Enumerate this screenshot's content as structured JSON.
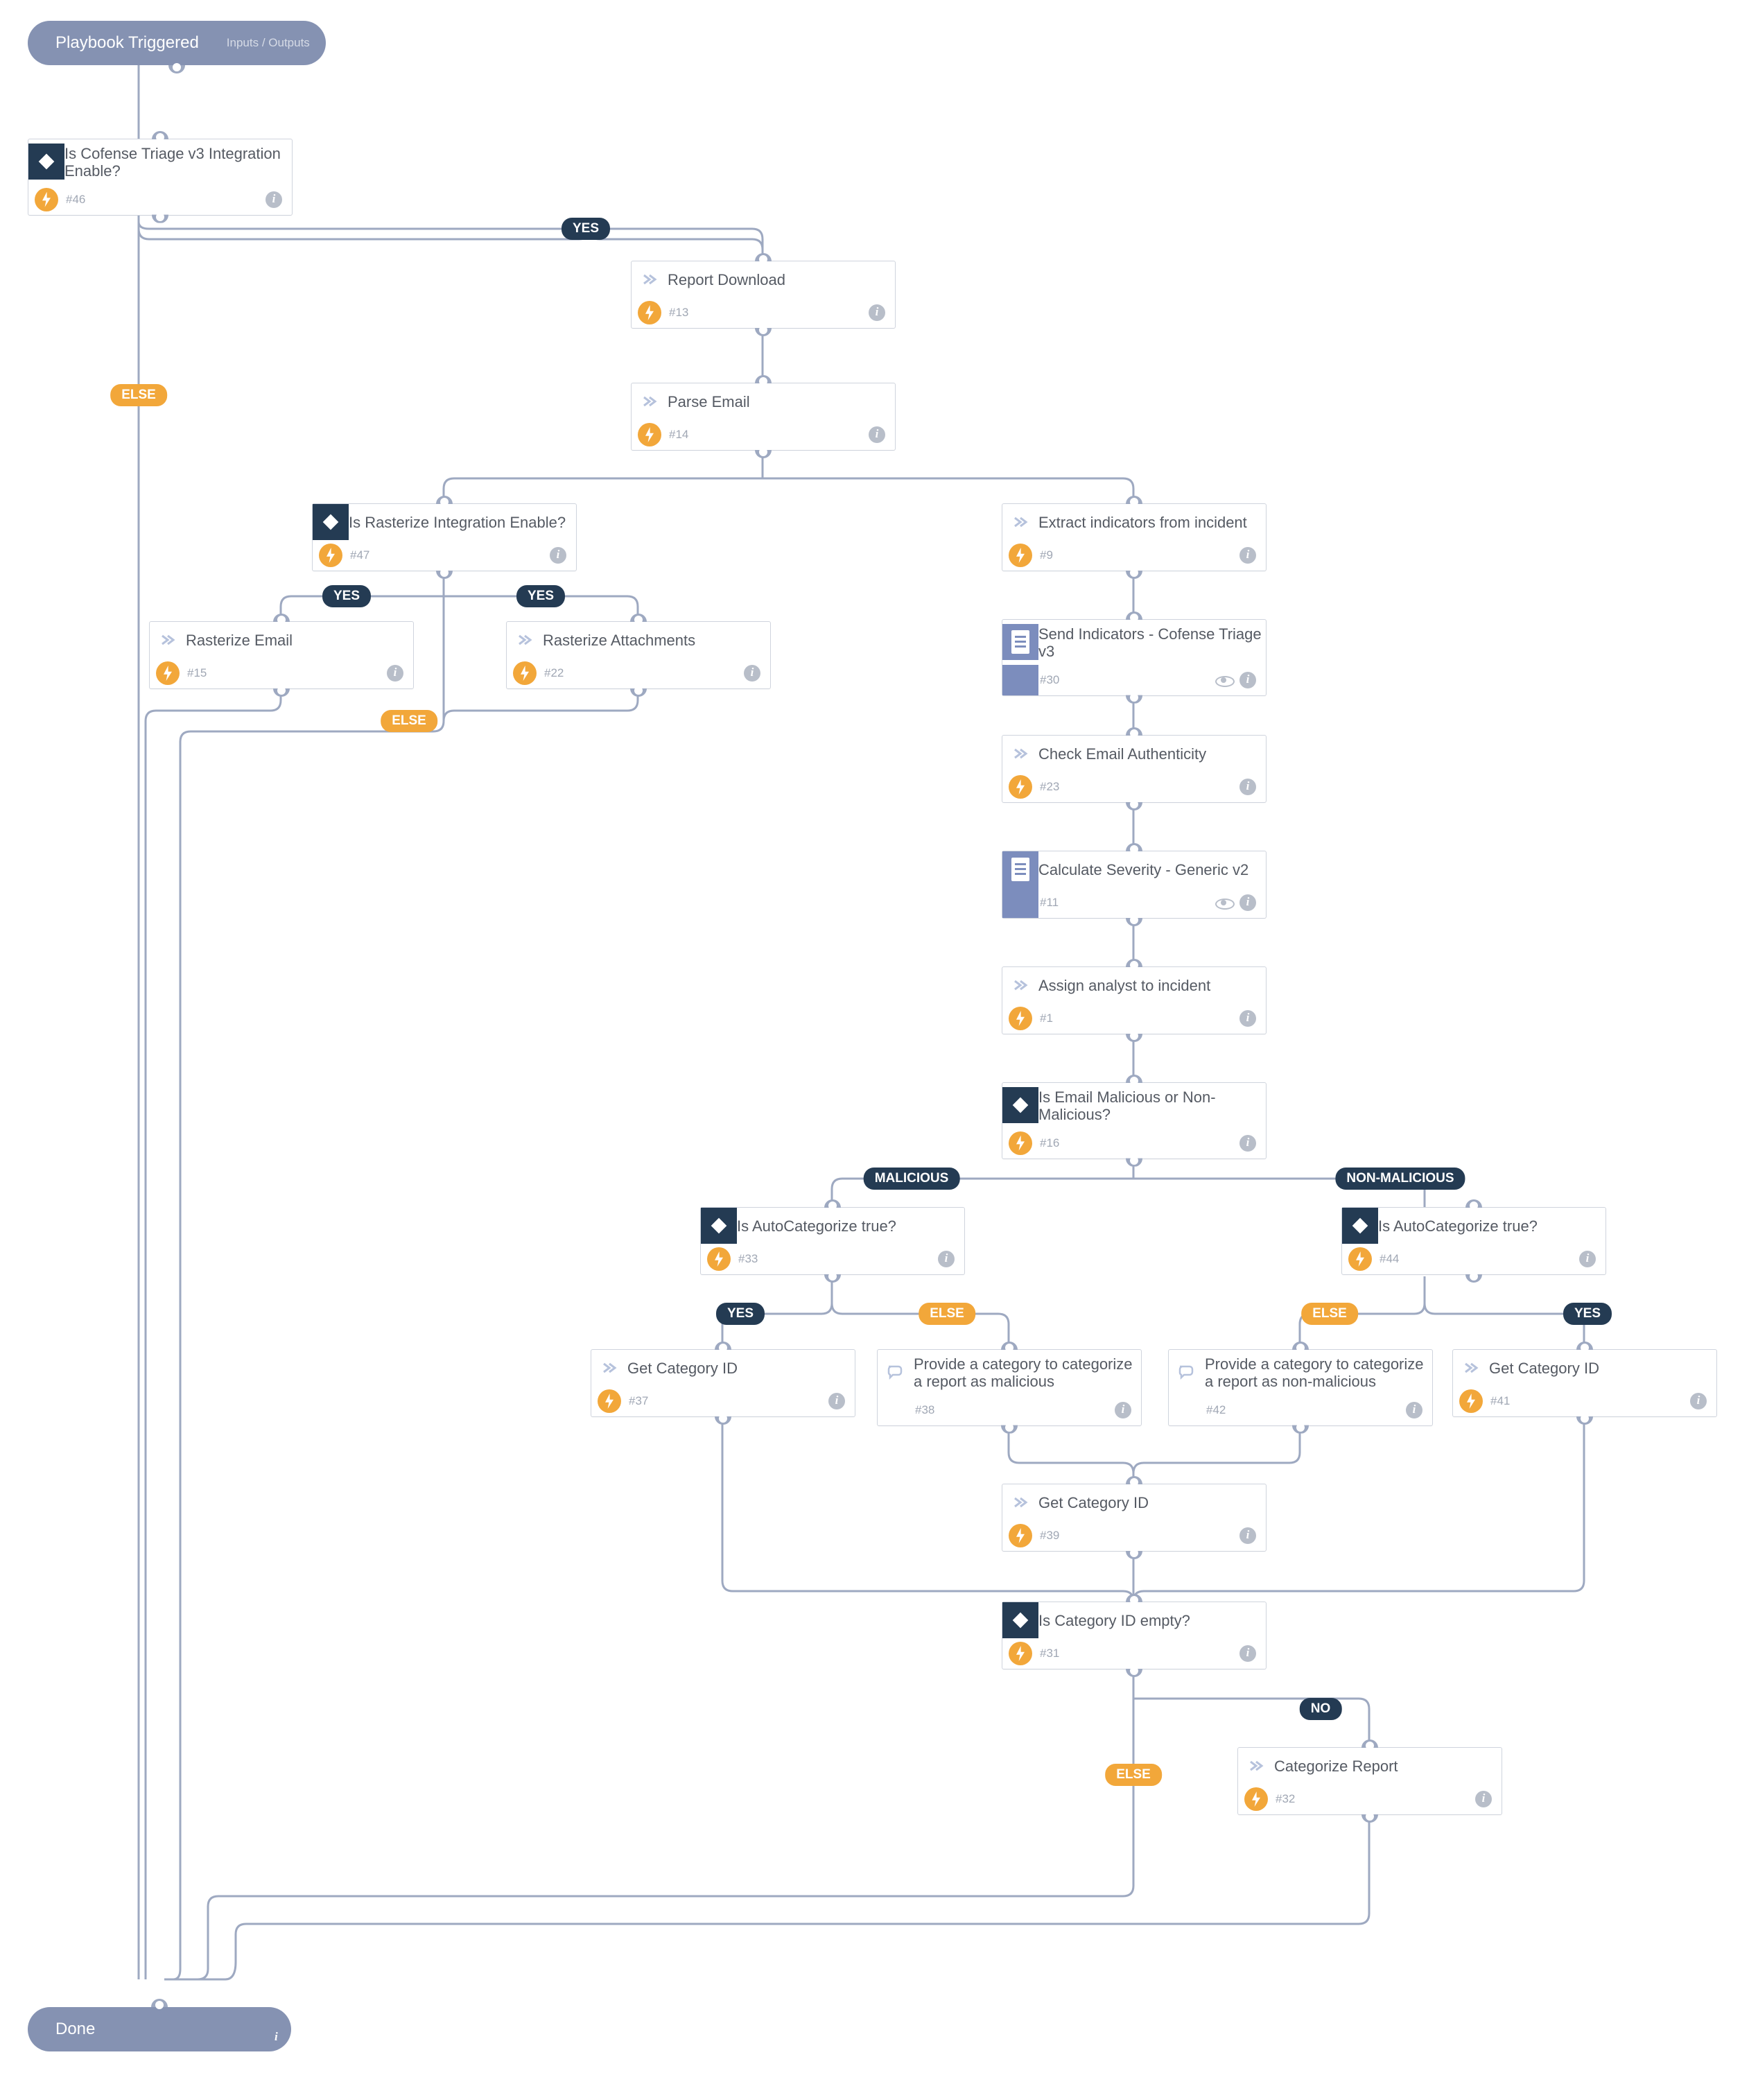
{
  "pills": {
    "start": {
      "title": "Playbook Triggered",
      "sub": "Inputs / Outputs"
    },
    "end": {
      "title": "Done"
    }
  },
  "nodes": {
    "n46": {
      "title": "Is Cofense Triage v3 Integration Enable?",
      "num": "#46"
    },
    "n13": {
      "title": "Report Download",
      "num": "#13"
    },
    "n14": {
      "title": "Parse Email",
      "num": "#14"
    },
    "n47": {
      "title": "Is Rasterize Integration Enable?",
      "num": "#47"
    },
    "n15": {
      "title": "Rasterize Email",
      "num": "#15"
    },
    "n22": {
      "title": "Rasterize Attachments",
      "num": "#22"
    },
    "n9": {
      "title": "Extract indicators from incident",
      "num": "#9"
    },
    "n30": {
      "title": "Send Indicators - Cofense Triage v3",
      "num": "#30"
    },
    "n23": {
      "title": "Check Email Authenticity",
      "num": "#23"
    },
    "n11": {
      "title": "Calculate Severity - Generic v2",
      "num": "#11"
    },
    "n1": {
      "title": "Assign analyst to incident",
      "num": "#1"
    },
    "n16": {
      "title": "Is Email Malicious or Non-Malicious?",
      "num": "#16"
    },
    "n33": {
      "title": "Is AutoCategorize true?",
      "num": "#33"
    },
    "n44": {
      "title": "Is AutoCategorize true?",
      "num": "#44"
    },
    "n37": {
      "title": "Get Category ID",
      "num": "#37"
    },
    "n38": {
      "title": "Provide a category to categorize a report as malicious",
      "num": "#38"
    },
    "n42": {
      "title": "Provide a category to categorize a report as non-malicious",
      "num": "#42"
    },
    "n41": {
      "title": "Get Category ID",
      "num": "#41"
    },
    "n39": {
      "title": "Get Category ID",
      "num": "#39"
    },
    "n31": {
      "title": "Is Category ID empty?",
      "num": "#31"
    },
    "n32": {
      "title": "Categorize Report",
      "num": "#32"
    }
  },
  "labels": {
    "yes": "YES",
    "no": "NO",
    "else": "ELSE",
    "malicious": "MALICIOUS",
    "nonmalicious": "NON-MALICIOUS"
  }
}
